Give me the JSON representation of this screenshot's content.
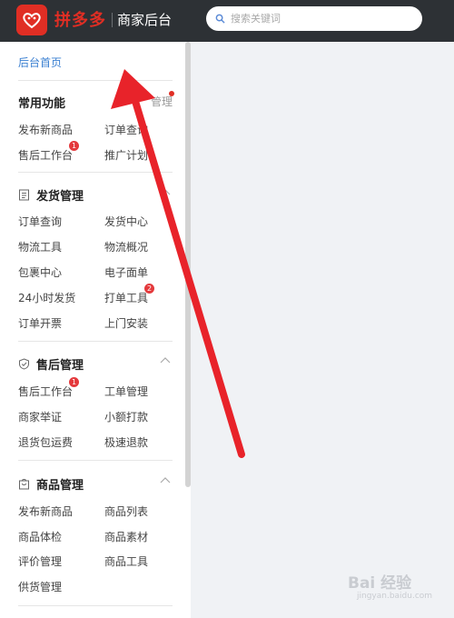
{
  "header": {
    "brand": "拼多多",
    "subbrand": "商家后台",
    "search_placeholder": "搜索关键词"
  },
  "sidebar": {
    "home": "后台首页",
    "common": {
      "title": "常用功能",
      "manage": "管理",
      "items": [
        "发布新商品",
        "订单查询",
        "售后工作台",
        "推广计划"
      ],
      "badges": {
        "售后工作台": "1"
      }
    },
    "shipping": {
      "title": "发货管理",
      "items": [
        "订单查询",
        "发货中心",
        "物流工具",
        "物流概况",
        "包裹中心",
        "电子面单",
        "24小时发货",
        "打单工具",
        "订单开票",
        "上门安装"
      ],
      "badges": {
        "打单工具": "2"
      }
    },
    "aftersale": {
      "title": "售后管理",
      "items": [
        "售后工作台",
        "工单管理",
        "商家举证",
        "小额打款",
        "退货包运费",
        "极速退款"
      ],
      "badges": {
        "售后工作台": "1"
      }
    },
    "goods": {
      "title": "商品管理",
      "items": [
        "发布新商品",
        "商品列表",
        "商品体检",
        "商品素材",
        "评价管理",
        "商品工具",
        "供货管理"
      ]
    }
  },
  "watermark": {
    "text": "Bai 经验",
    "sub": "jingyan.baidu.com"
  },
  "colors": {
    "brand": "#e02e24",
    "topbar": "#2d3135",
    "link": "#3a7fd1",
    "arrow": "#e8232a",
    "content_bg": "#f0f2f5"
  },
  "icons": {
    "logo": "pinduoduo-logo-icon",
    "search": "search-icon",
    "shipping": "document-icon",
    "aftersale": "shield-check-icon",
    "goods": "bag-icon",
    "collapse": "chevron-up-icon"
  }
}
